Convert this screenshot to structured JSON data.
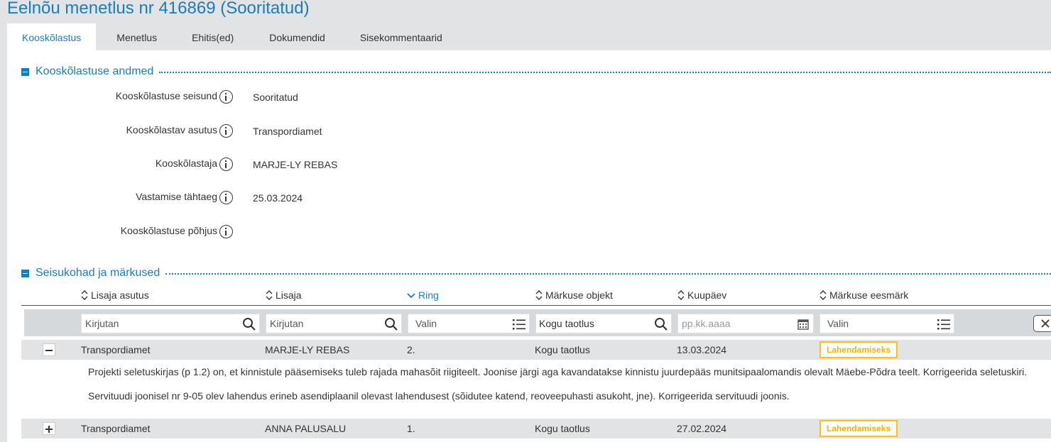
{
  "page": {
    "title": "Eelnõu menetlus nr 416869 (Sooritatud)"
  },
  "tabs": [
    {
      "label": "Kooskõlastus"
    },
    {
      "label": "Menetlus"
    },
    {
      "label": "Ehitis(ed)"
    },
    {
      "label": "Dokumendid"
    },
    {
      "label": "Sisekommentaarid"
    }
  ],
  "section1": {
    "title": "Kooskõlastuse andmed",
    "fields": [
      {
        "label": "Kooskõlastuse seisund",
        "value": "Sooritatud"
      },
      {
        "label": "Kooskõlastav asutus",
        "value": "Transpordiamet"
      },
      {
        "label": "Kooskõlastaja",
        "value": "MARJE-LY REBAS"
      },
      {
        "label": "Vastamise tähtaeg",
        "value": "25.03.2024"
      },
      {
        "label": "Kooskõlastuse põhjus",
        "value": ""
      }
    ]
  },
  "section2": {
    "title": "Seisukohad ja märkused",
    "columns": [
      {
        "label": "Lisaja asutus"
      },
      {
        "label": "Lisaja"
      },
      {
        "label": "Ring"
      },
      {
        "label": "Märkuse objekt"
      },
      {
        "label": "Kuupäev"
      },
      {
        "label": "Märkuse eesmärk"
      }
    ],
    "filters": {
      "asutus_placeholder": "Kirjutan",
      "lisaja_placeholder": "Kirjutan",
      "ring_placeholder": "Valin",
      "objekt_value": "Kogu taotlus",
      "kuupaev_placeholder": "pp.kk.aaaa",
      "eesmark_placeholder": "Valin"
    },
    "rows": [
      {
        "asutus": "Transpordiamet",
        "lisaja": "MARJE-LY REBAS",
        "ring": "2.",
        "objekt": "Kogu taotlus",
        "kuupaev": "13.03.2024",
        "eesmark": "Lahendamiseks",
        "comments": [
          "Projekti seletuskirjas (p 1.2) on, et kinnistule pääsemiseks tuleb rajada mahasõit riigiteelt. Joonise järgi aga kavandatakse kinnistu juurdepääs munitsipaalomandis olevalt Mäebe-Põdra teelt. Korrigeerida seletuskiri.",
          "Servituudi joonisel nr 9-05 olev lahendus erineb asendiplaanil olevast lahendusest (sõidutee katend, reoveepuhasti asukoht, jne). Korrigeerida servituudi joonis."
        ]
      },
      {
        "asutus": "Transpordiamet",
        "lisaja": "ANNA PALUSALU",
        "ring": "1.",
        "objekt": "Kogu taotlus",
        "kuupaev": "27.02.2024",
        "eesmark": "Lahendamiseks"
      }
    ]
  },
  "colors": {
    "accent": "#1b7db8",
    "badge": "#f7c31b",
    "panel_bg": "#e1e3e5"
  }
}
